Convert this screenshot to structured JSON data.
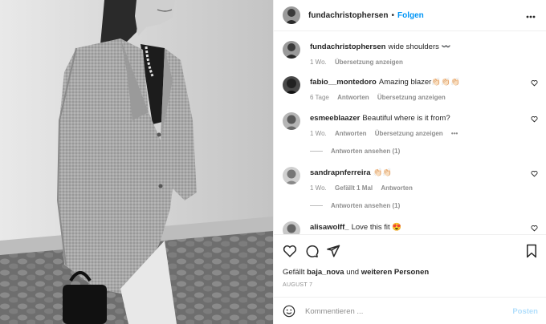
{
  "post": {
    "username": "fundachristophersen",
    "follow_label": "Folgen",
    "more_icon": "more-icon",
    "dot": "•"
  },
  "caption": {
    "username": "fundachristophersen",
    "text": "wide shoulders 〰️",
    "time": "1 Wo.",
    "translate": "Übersetzung anzeigen"
  },
  "comments": [
    {
      "username": "fabio__montedoro",
      "text": "Amazing blazer👏🏻👏🏻👏🏻",
      "time": "6 Tage",
      "reply": "Antworten",
      "translate": "Übersetzung anzeigen"
    },
    {
      "username": "esmeeblaazer",
      "text": "Beautiful where is it from?",
      "time": "1 Wo.",
      "reply": "Antworten",
      "translate": "Übersetzung anzeigen",
      "options": "•••",
      "view_replies": "Antworten ansehen (1)"
    },
    {
      "username": "sandrapnferreira",
      "text": "👏🏻👏🏻",
      "time": "1 Wo.",
      "likes": "Gefällt 1 Mal",
      "reply": "Antworten",
      "view_replies": "Antworten ansehen (1)"
    },
    {
      "username": "alisawolff_",
      "text": "Love this fit 😍"
    }
  ],
  "likes": {
    "prefix": "Gefällt",
    "user": "baja_nova",
    "middle": "und",
    "others": "weiteren Personen"
  },
  "date": "AUGUST 7",
  "comment_box": {
    "placeholder": "Kommentieren ...",
    "post_label": "Posten"
  },
  "colors": {
    "link_blue": "#0095f6",
    "post_disabled": "#b2dffc",
    "muted": "#8e8e8e",
    "text": "#262626"
  }
}
